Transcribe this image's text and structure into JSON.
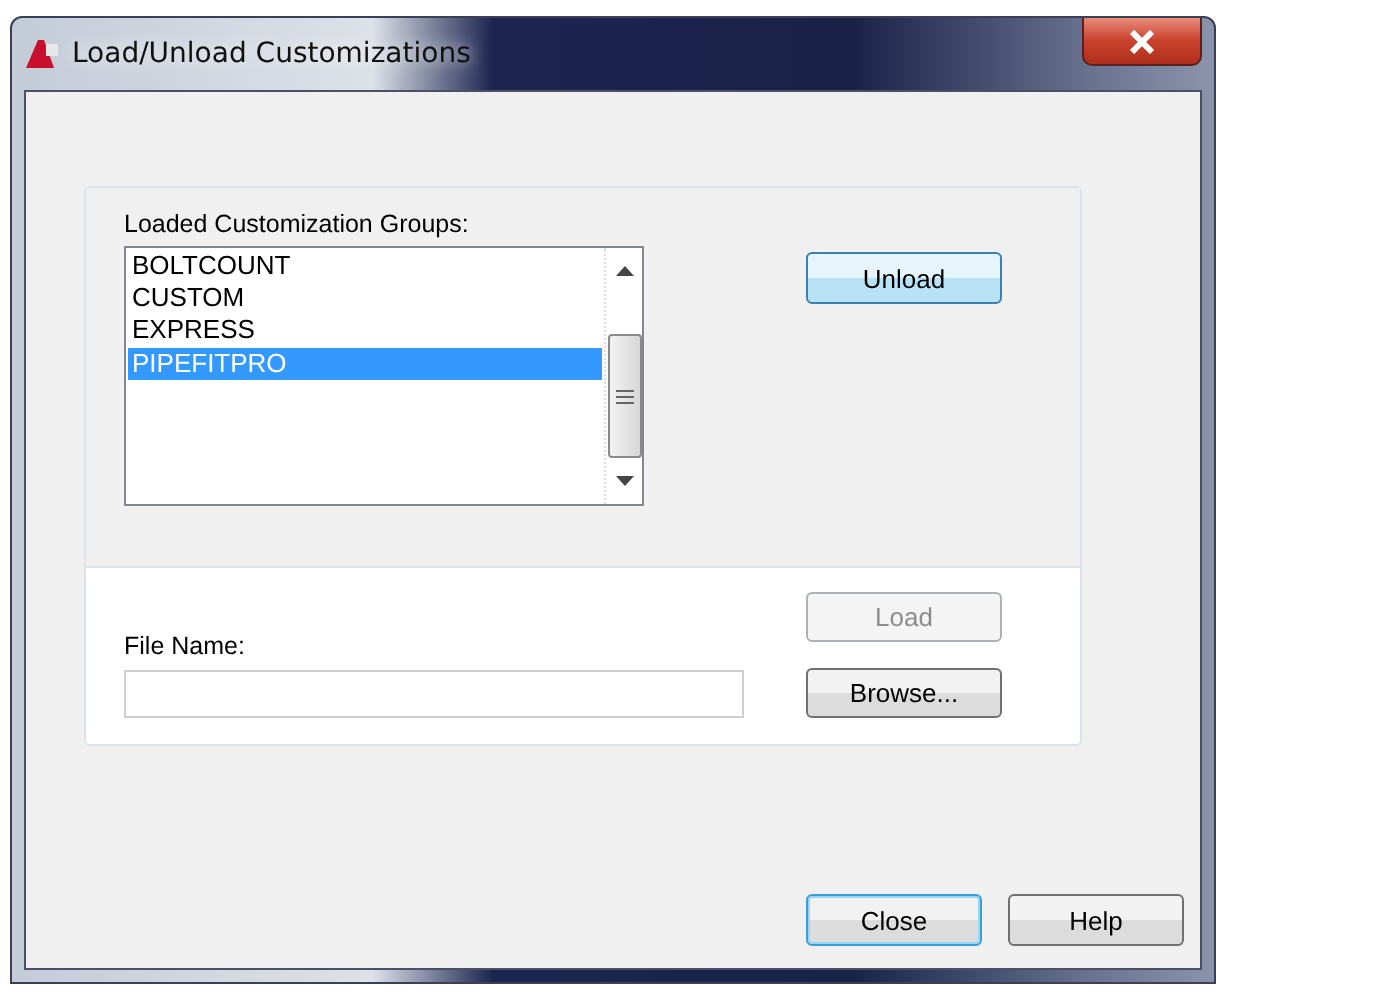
{
  "window": {
    "title": "Load/Unload Customizations"
  },
  "groups": {
    "label": "Loaded Customization Groups:",
    "items": [
      {
        "label": "BOLTCOUNT",
        "selected": false
      },
      {
        "label": "CUSTOM",
        "selected": false
      },
      {
        "label": "EXPRESS",
        "selected": false
      },
      {
        "label": "PIPEFITPRO",
        "selected": true
      }
    ]
  },
  "unload_button": {
    "label": "Unload",
    "highlighted": true
  },
  "load_button": {
    "label": "Load",
    "disabled": true
  },
  "browse_button": {
    "label": "Browse...",
    "disabled": false
  },
  "file_name": {
    "label": "File Name:"
  },
  "footer_buttons": [
    {
      "label": "Close",
      "default": true
    },
    {
      "label": "Help",
      "default": false
    }
  ]
}
